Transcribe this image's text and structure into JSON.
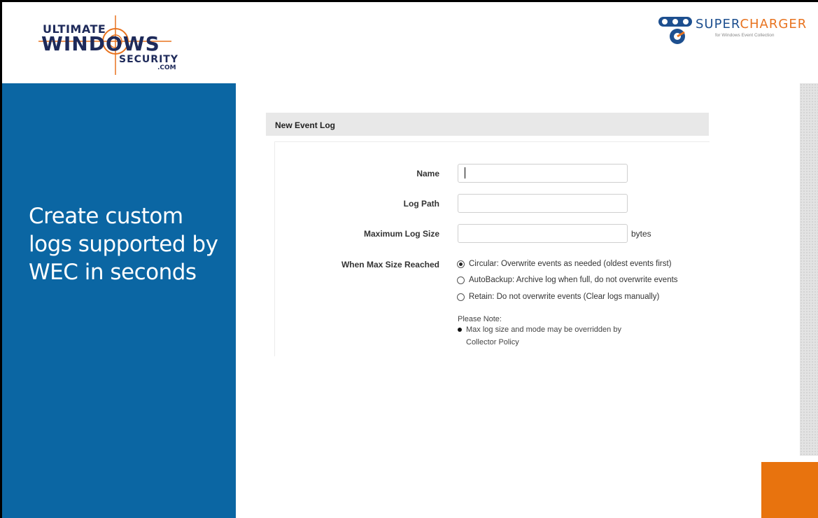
{
  "logos": {
    "uws": {
      "line1": "ULTIMATE",
      "line2": "WINDOWS",
      "line3": "SECURITY",
      "line4": ".COM"
    },
    "supercharger": {
      "word_part1": "SUPER",
      "word_part2": "CHARGER",
      "tagline": "for Windows Event Collection"
    }
  },
  "side": {
    "title": "Create custom logs supported by WEC in seconds"
  },
  "form": {
    "header": "New Event Log",
    "fields": {
      "name_label": "Name",
      "name_value": "",
      "log_path_label": "Log Path",
      "log_path_value": "",
      "max_size_label": "Maximum Log Size",
      "max_size_value": "",
      "max_size_unit": "bytes"
    },
    "when_full": {
      "label": "When Max Size Reached",
      "options": [
        {
          "label": "Circular: Overwrite events as needed (oldest events first)",
          "checked": true
        },
        {
          "label": "AutoBackup: Archive log when full, do not overwrite events",
          "checked": false
        },
        {
          "label": "Retain: Do not overwrite events (Clear logs manually)",
          "checked": false
        }
      ]
    },
    "note": {
      "title": "Please Note:",
      "line1": "Max log size and mode may be overridden by",
      "line2": "Collector Policy"
    }
  },
  "colors": {
    "panel_blue": "#0b66a3",
    "accent_orange": "#e8730e",
    "logo_navy": "#1e2a5a"
  }
}
